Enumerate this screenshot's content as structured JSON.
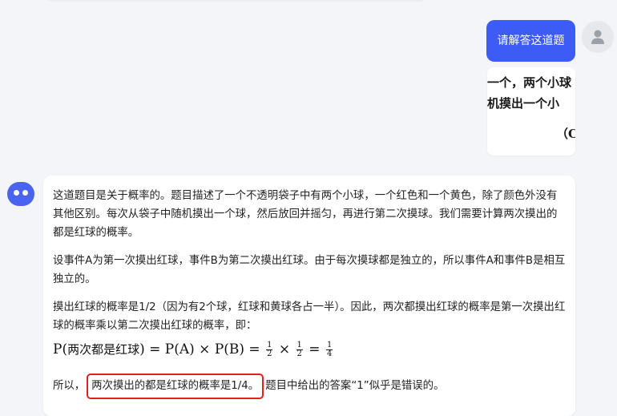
{
  "user_message": {
    "text": "请解答这道题",
    "image_lines": [
      "一个，两个小球",
      "机摸出一个小",
      "（C"
    ]
  },
  "assistant_message": {
    "paragraphs": [
      "这道题目是关于概率的。题目描述了一个不透明袋子中有两个小球，一个红色和一个黄色，除了颜色外没有其他区别。每次从袋子中随机摸出一个球，然后放回并摇匀，再进行第二次摸球。我们需要计算两次摸出的都是红球的概率。",
      "设事件A为第一次摸出红球，事件B为第二次摸出红球。由于每次摸球都是独立的，所以事件A和事件B是相互独立的。",
      "摸出红球的概率是1/2（因为有2个球，红球和黄球各占一半）。因此，两次都摸出红球的概率是第一次摸出红球的概率乘以第二次摸出红球的概率，即："
    ],
    "formula": {
      "lhs_p": "P(",
      "lhs_event": "两次都是红球",
      "lhs_close": ") = ",
      "rhs_a": "P(A) × P(B) = ",
      "times": " × ",
      "eq": " = ",
      "frac_num": "1",
      "frac_den": "2",
      "result_num": "1",
      "result_den": "4"
    },
    "conclusion": {
      "prefix": "所以，",
      "highlight": "两次摸出的都是红球的概率是1/4。",
      "suffix": "题目中给出的答案“1”似乎是错误的。"
    }
  },
  "colors": {
    "accent": "#3d5cf5",
    "highlight_border": "#e0201b",
    "background": "#f3f5f9"
  }
}
